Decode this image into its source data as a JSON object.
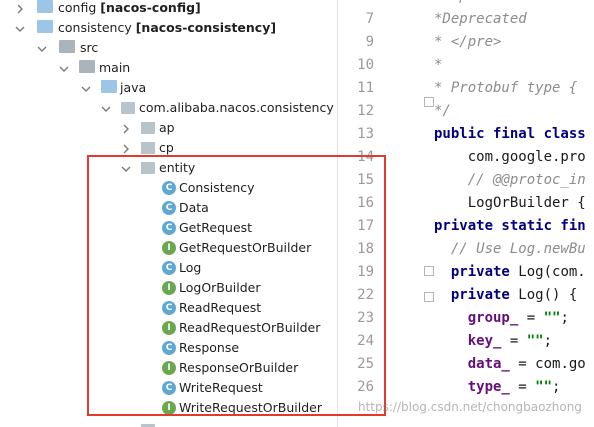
{
  "tree": [
    {
      "label": "config",
      "tag": "[nacos-config]"
    },
    {
      "label": "consistency",
      "tag": "[nacos-consistency]"
    },
    {
      "label": "src"
    },
    {
      "label": "main"
    },
    {
      "label": "java"
    },
    {
      "label": "com.alibaba.nacos.consistency"
    },
    {
      "label": "ap"
    },
    {
      "label": "cp"
    },
    {
      "label": "entity"
    },
    {
      "label": "Consistency",
      "kind": "C"
    },
    {
      "label": "Data",
      "kind": "C"
    },
    {
      "label": "GetRequest",
      "kind": "C"
    },
    {
      "label": "GetRequestOrBuilder",
      "kind": "I"
    },
    {
      "label": "Log",
      "kind": "C"
    },
    {
      "label": "LogOrBuilder",
      "kind": "I"
    },
    {
      "label": "ReadRequest",
      "kind": "C"
    },
    {
      "label": "ReadRequestOrBuilder",
      "kind": "I"
    },
    {
      "label": "Response",
      "kind": "C"
    },
    {
      "label": "ResponseOrBuilder",
      "kind": "I"
    },
    {
      "label": "WriteRequest",
      "kind": "C"
    },
    {
      "label": "WriteRequestOrBuilder",
      "kind": "I"
    }
  ],
  "editor": {
    "lines": [
      {
        "num": "7",
        "text": "*Deprecated",
        "style": "cmt"
      },
      {
        "num": "9",
        "text": "* </pre>",
        "style": "cmt"
      },
      {
        "num": "10",
        "text": "*",
        "style": "cmt"
      },
      {
        "num": "11",
        "text": "* Protobuf type {",
        "style": "cmt"
      },
      {
        "num": "12",
        "text": "*/",
        "style": "cmt"
      },
      {
        "num": "13",
        "text": "public final class",
        "style": "kw"
      },
      {
        "num": "14",
        "text": "    com.google.pro",
        "style": "plain"
      },
      {
        "num": "15",
        "text": "    // @@protoc_in",
        "style": "cmt"
      },
      {
        "num": "16",
        "text": "    LogOrBuilder {",
        "style": "plain"
      },
      {
        "num": "17",
        "text": "private static fin",
        "style": "kw"
      },
      {
        "num": "18",
        "text": "  // Use Log.newBu",
        "style": "cmt"
      },
      {
        "num": "19",
        "text": "  private Log(com.",
        "style": "mix1"
      },
      {
        "num": "22",
        "text": "  private Log() {",
        "style": "mix1"
      },
      {
        "num": "23",
        "text": "    group_ = \"\";",
        "style": "field"
      },
      {
        "num": "24",
        "text": "    key_ = \"\";",
        "style": "field"
      },
      {
        "num": "25",
        "text": "    data_ = com.go",
        "style": "field2"
      },
      {
        "num": "26",
        "text": "    type_ = \"\";",
        "style": "field"
      }
    ]
  },
  "watermark": "https://blog.csdn.net/chongbaozhong"
}
